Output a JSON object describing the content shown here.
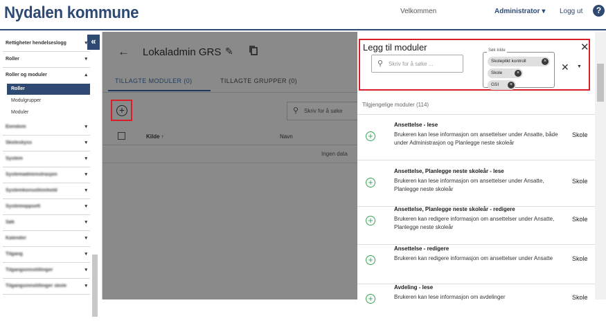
{
  "header": {
    "brand": "Nydalen kommune",
    "welcome": "Velkommen",
    "admin_label": "Administrator ▾",
    "logout": "Logg ut",
    "help": "?"
  },
  "sidebar": {
    "collapse": "«",
    "items": [
      {
        "label": "Rettigheter hendelseslogg",
        "caret": "▾"
      },
      {
        "label": "Roller",
        "caret": "▾"
      },
      {
        "label": "Roller og moduler",
        "caret": "▴"
      }
    ],
    "subitems": [
      "Roller",
      "Modulgrupper",
      "Moduler"
    ],
    "blurred_items": [
      "Eiendom",
      "Skoleskyss",
      "System",
      "Systemadministrasjon",
      "Systemkonsollinnhold",
      "Systemoppsett",
      "Søk",
      "Kalender",
      "Tilgang",
      "Tilgangsinnstillinger",
      "Tilgangsinnstillinger skole"
    ]
  },
  "main": {
    "title": "Lokaladmin GRS",
    "tabs": [
      "TILLAGTE MODULER (0)",
      "TILLAGTE GRUPPER (0)"
    ],
    "search_placeholder": "Skriv for å søke",
    "columns": [
      "Kilde ↑",
      "Navn"
    ],
    "no_data": "Ingen data"
  },
  "panel": {
    "title": "Legg til moduler",
    "search_placeholder": "Skriv for å søke ...",
    "source_label": "Søk kilde",
    "chips": [
      "Skoleplikt kontroll",
      "Skole",
      "GSI"
    ],
    "available": "Tilgjengelige moduler (114)",
    "modules": [
      {
        "name": "Ansettelse - lese",
        "desc": "Brukeren kan lese informasjon om ansettelser under Ansatte, både under Administrasjon og Planlegge neste skoleår",
        "source": "Skole"
      },
      {
        "name": "Ansettelse, Planlegge neste skoleår - lese",
        "desc": "Brukeren kan lese informasjon om ansettelser under Ansatte, Planlegge neste skoleår",
        "source": "Skole"
      },
      {
        "name": "Ansettelse, Planlegge neste skoleår - redigere",
        "desc": "Brukeren kan redigere informasjon om ansettelser under Ansatte, Planlegge neste skoleår",
        "source": "Skole"
      },
      {
        "name": "Ansettelse - redigere",
        "desc": "Brukeren kan redigere informasjon om ansettelser under Ansatte",
        "source": "Skole"
      },
      {
        "name": "Avdeling - lese",
        "desc": "Brukeren kan lese informasjon om avdelinger",
        "source": "Skole"
      }
    ]
  }
}
